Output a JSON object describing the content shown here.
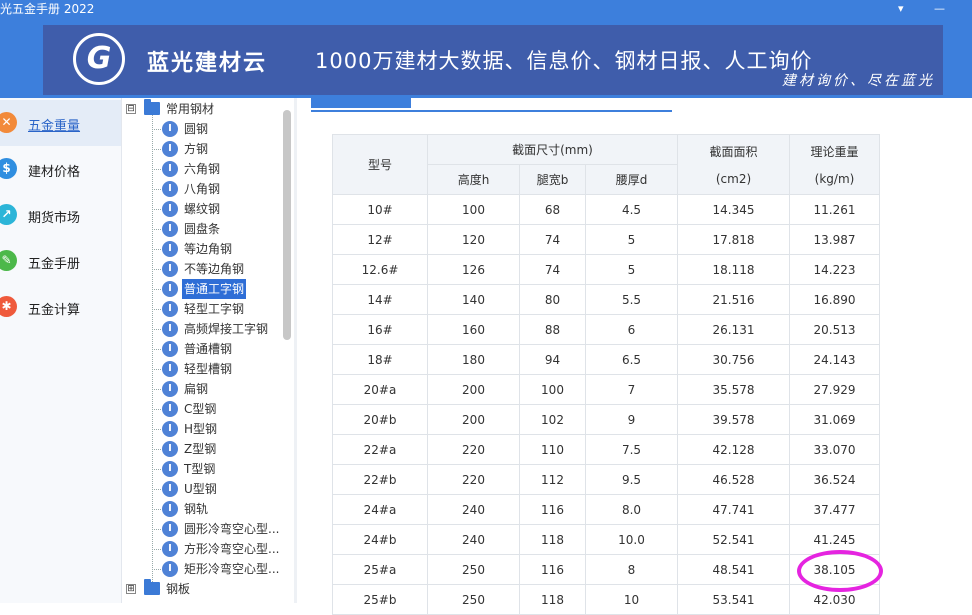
{
  "window": {
    "title": "光五金手册 2022",
    "controls": [
      "▾",
      "—"
    ]
  },
  "banner": {
    "logo_letter": "G",
    "brand": "蓝光建材云",
    "slogan": "1000万建材大数据、信息价、钢材日报、人工询价",
    "tagline": "建材询价、尽在蓝光"
  },
  "nav": {
    "items": [
      {
        "label": "五金重量",
        "icon": "steel-weight-icon",
        "color": "#f28a3a",
        "active": true
      },
      {
        "label": "建材价格",
        "icon": "dollar-icon",
        "color": "#2f8ee0",
        "active": false
      },
      {
        "label": "期货市场",
        "icon": "trend-chart-icon",
        "color": "#2cb5d8",
        "active": false
      },
      {
        "label": "五金手册",
        "icon": "wrench-icon",
        "color": "#4cb84a",
        "active": false
      },
      {
        "label": "五金计算",
        "icon": "tools-icon",
        "color": "#ef5a3c",
        "active": false
      }
    ]
  },
  "tree": {
    "root": {
      "label": "常用钢材",
      "expander": "⊟"
    },
    "items": [
      "圆钢",
      "方钢",
      "六角钢",
      "八角钢",
      "螺纹钢",
      "圆盘条",
      "等边角钢",
      "不等边角钢",
      "普通工字钢",
      "轻型工字钢",
      "高频焊接工字钢",
      "普通槽钢",
      "轻型槽钢",
      "扁钢",
      "C型钢",
      "H型钢",
      "Z型钢",
      "T型钢",
      "U型钢",
      "钢轨",
      "圆形冷弯空心型...",
      "方形冷弯空心型...",
      "矩形冷弯空心型..."
    ],
    "selected": "普通工字钢",
    "leaf_badge": "I",
    "next_root": {
      "label": "钢板",
      "expander": "⊞"
    }
  },
  "table": {
    "headers": {
      "model": "型号",
      "section_size": "截面尺寸(mm)",
      "height": "高度h",
      "leg_width": "腿宽b",
      "web_thickness": "腰厚d",
      "area": "截面面积",
      "area_unit": "(cm2)",
      "weight": "理论重量",
      "weight_unit": "(kg/m)"
    },
    "rows": [
      [
        "10#",
        "100",
        "68",
        "4.5",
        "14.345",
        "11.261"
      ],
      [
        "12#",
        "120",
        "74",
        "5",
        "17.818",
        "13.987"
      ],
      [
        "12.6#",
        "126",
        "74",
        "5",
        "18.118",
        "14.223"
      ],
      [
        "14#",
        "140",
        "80",
        "5.5",
        "21.516",
        "16.890"
      ],
      [
        "16#",
        "160",
        "88",
        "6",
        "26.131",
        "20.513"
      ],
      [
        "18#",
        "180",
        "94",
        "6.5",
        "30.756",
        "24.143"
      ],
      [
        "20#a",
        "200",
        "100",
        "7",
        "35.578",
        "27.929"
      ],
      [
        "20#b",
        "200",
        "102",
        "9",
        "39.578",
        "31.069"
      ],
      [
        "22#a",
        "220",
        "110",
        "7.5",
        "42.128",
        "33.070"
      ],
      [
        "22#b",
        "220",
        "112",
        "9.5",
        "46.528",
        "36.524"
      ],
      [
        "24#a",
        "240",
        "116",
        "8.0",
        "47.741",
        "37.477"
      ],
      [
        "24#b",
        "240",
        "118",
        "10.0",
        "52.541",
        "41.245"
      ],
      [
        "25#a",
        "250",
        "116",
        "8",
        "48.541",
        "38.105"
      ],
      [
        "25#b",
        "250",
        "118",
        "10",
        "53.541",
        "42.030"
      ]
    ],
    "highlight_color": "#e524e0"
  }
}
